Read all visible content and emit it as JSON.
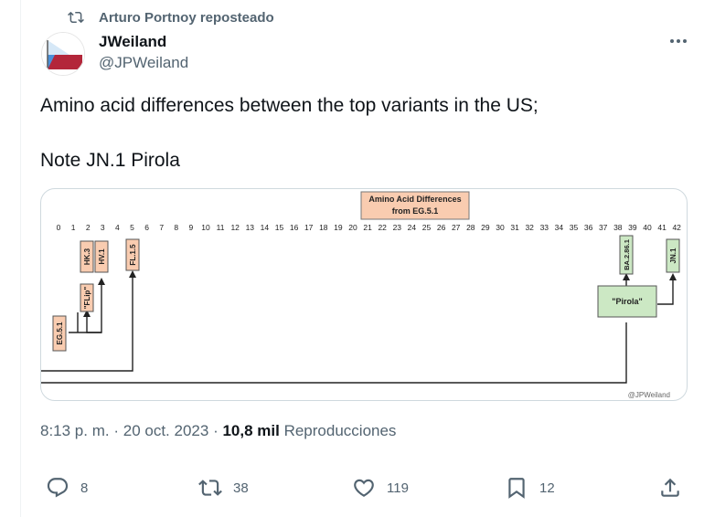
{
  "repost": {
    "text": "Arturo Portnoy reposteado",
    "icon": "repost-icon"
  },
  "author": {
    "name": "JWeiland",
    "handle": "@JPWeiland"
  },
  "tweet": {
    "line1": "Amino acid differences between the top variants in the US;",
    "line2": "Note JN.1 Pirola"
  },
  "diagram": {
    "title_line1": "Amino Acid Differences",
    "title_line2": "from EG.5.1",
    "scale": [
      "0",
      "1",
      "2",
      "3",
      "4",
      "5",
      "6",
      "7",
      "8",
      "9",
      "10",
      "11",
      "12",
      "13",
      "14",
      "15",
      "16",
      "17",
      "18",
      "19",
      "20",
      "21",
      "22",
      "23",
      "24",
      "25",
      "26",
      "27",
      "28",
      "29",
      "30",
      "31",
      "32",
      "33",
      "34",
      "35",
      "36",
      "37",
      "38",
      "39",
      "40",
      "41",
      "42"
    ],
    "variants": {
      "eg51": "EG.5.1",
      "flip": "\"FLip\"",
      "hk3": "HK.3",
      "hv1": "HV.1",
      "fl15": "FL.1.5",
      "ba286": "BA.2.86.1",
      "pirola": "\"Pirola\"",
      "jn1": "JN.1"
    },
    "credit": "@JPWeiland",
    "colors": {
      "orange": "#f9ccb0",
      "green": "#cce8c4"
    }
  },
  "meta": {
    "time": "8:13 p. m.",
    "sep1": "·",
    "date": "20 oct. 2023",
    "sep2": "·",
    "views_count": "10,8 mil",
    "views_label": "Reproducciones"
  },
  "actions": {
    "replies": "8",
    "reposts": "38",
    "likes": "119",
    "bookmarks": "12"
  },
  "colors": {
    "text": "#0f1419",
    "secondary": "#536471",
    "border": "#cfd9de"
  }
}
